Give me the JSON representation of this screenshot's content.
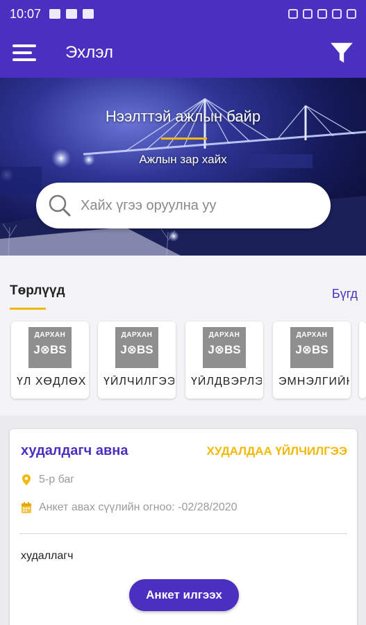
{
  "status_bar": {
    "time": "10:07"
  },
  "app_bar": {
    "title": "Эхлэл"
  },
  "hero": {
    "title": "Нээлттэй ажлын байр",
    "subtitle": "Ажлын зар хайх"
  },
  "search": {
    "placeholder": "Хайх үгээ оруулна уу"
  },
  "categories": {
    "title": "Төрлүүд",
    "all_label": "Бүгд",
    "logo_line1": "ДАРХАН",
    "logo_line2": "J⊗BS",
    "items": [
      {
        "label": "ҮЛ ХӨДЛӨХ"
      },
      {
        "label": "ҮЙЛЧИЛГЭЭ"
      },
      {
        "label": "ҮЙЛДВЭРЛЭЛ"
      },
      {
        "label": "ЭМНЭЛГИЙН"
      },
      {
        "label": ""
      }
    ]
  },
  "job": {
    "title": "худалдагч авна",
    "category": "ХУДАЛДАА ҮЙЛЧИЛГЭЭ",
    "location": "5-р баг",
    "deadline": "Анкет авах сүүлийн огноо: -02/28/2020",
    "description": "худаллагч",
    "apply_label": "Анкет илгээх"
  },
  "colors": {
    "primary": "#4a2fc0",
    "accent": "#f2b90a",
    "background": "#ececf0"
  },
  "icons": [
    "menu-icon",
    "filter-icon",
    "search-icon",
    "location-pin-icon",
    "calendar-icon"
  ]
}
